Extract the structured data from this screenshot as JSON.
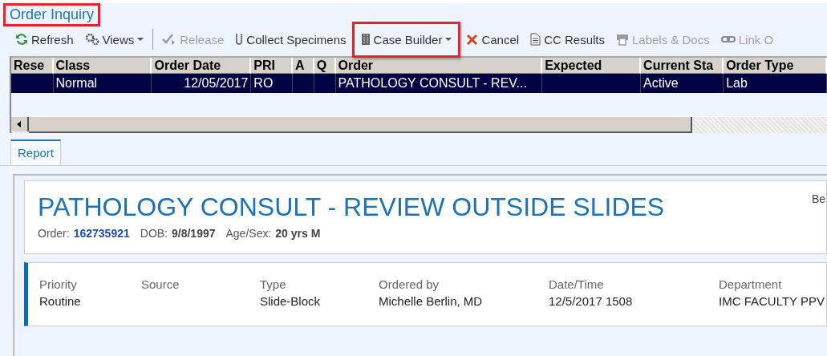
{
  "title": {
    "text": "Order Inquiry",
    "highlighted": true
  },
  "toolbar": [
    {
      "label": "Refresh",
      "disabled": false,
      "dropdown": false,
      "highlighted": false
    },
    {
      "label": "Views",
      "disabled": false,
      "dropdown": true,
      "highlighted": false
    },
    {
      "label": "Release",
      "disabled": true,
      "dropdown": false,
      "highlighted": false
    },
    {
      "label": "Collect Specimens",
      "disabled": false,
      "dropdown": false,
      "highlighted": false
    },
    {
      "label": "Case Builder",
      "disabled": false,
      "dropdown": true,
      "highlighted": true
    },
    {
      "label": "Cancel",
      "disabled": false,
      "dropdown": false,
      "highlighted": false
    },
    {
      "label": "CC Results",
      "disabled": false,
      "dropdown": false,
      "highlighted": false
    },
    {
      "label": "Labels & Docs",
      "disabled": true,
      "dropdown": false,
      "highlighted": false
    },
    {
      "label": "Link O",
      "disabled": true,
      "dropdown": false,
      "highlighted": false
    }
  ],
  "table": {
    "columns": [
      "Rese",
      "Class",
      "Order Date",
      "PRI",
      "A",
      "Q",
      "Order",
      "Expected",
      "Current Sta",
      "Order Type"
    ],
    "rows": [
      {
        "selected": true,
        "cells": [
          null,
          "Normal",
          "12/05/2017",
          "RO",
          null,
          null,
          "PATHOLOGY CONSULT - REV...",
          null,
          "Active",
          "Lab"
        ]
      }
    ]
  },
  "tabs": [
    {
      "label": "Report",
      "selected": true
    }
  ],
  "report": {
    "heading": "PATHOLOGY CONSULT - REVIEW OUTSIDE SLIDES",
    "corner_text": "Be",
    "meta": [
      {
        "label": "Order:",
        "value": "162735921",
        "kind": "link"
      },
      {
        "label": "DOB:",
        "value": "9/8/1997",
        "kind": "plain"
      },
      {
        "label": "Age/Sex:",
        "value": "20 yrs M",
        "kind": "plain"
      }
    ],
    "details": [
      {
        "label": "Priority",
        "value": "Routine"
      },
      {
        "label": "Source"
      },
      {
        "label": "Type",
        "value": "Slide-Block"
      },
      {
        "label": "Ordered by",
        "value": "Michelle Berlin, MD"
      },
      {
        "label": "Date/Time",
        "value": "12/5/2017 1508"
      },
      {
        "label": "Department",
        "value": "IMC FACULTY PPV"
      }
    ]
  }
}
